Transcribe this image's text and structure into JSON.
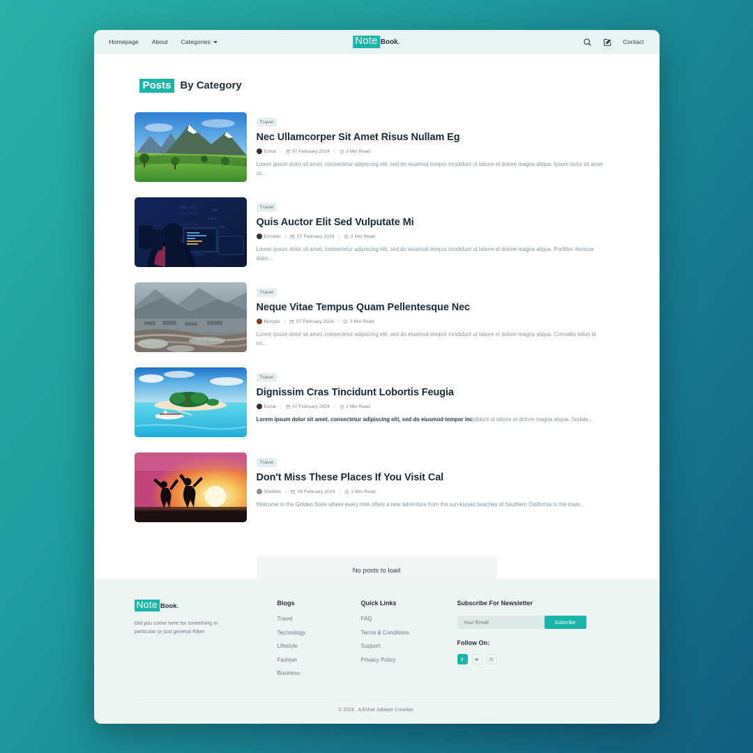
{
  "theme": {
    "accent": "#19b5a8",
    "page_bg": "#ffffff",
    "header_bg": "#e9f4f2",
    "footer_bg": "#eff5f3",
    "backdrop": "#1f9c9c"
  },
  "header": {
    "nav": [
      {
        "label": "Homepage",
        "caret": false
      },
      {
        "label": "About",
        "caret": false
      },
      {
        "label": "Categories",
        "caret": true
      }
    ],
    "logo": {
      "mark": "Note",
      "text": "Book",
      "dot": "."
    },
    "icons": [
      {
        "name": "search-icon"
      },
      {
        "name": "write-icon"
      }
    ],
    "contact_label": "Contact"
  },
  "main": {
    "title_highlight": "Posts",
    "title_rest": "By Category",
    "posts": [
      {
        "category": "Travel",
        "title": "Nec Ullamcorper Sit Amet Risus Nullam Eg",
        "author": "Eshat",
        "date": "07 February 2024",
        "read_time": "3 Min Read",
        "excerpt": "Lorem ipsum dolor sit amet, consectetur adipiscing elit, sed do eiusmod tempor incididunt ut labore et dolore magna aliqua. Ipsum dolor sit amet co...",
        "excerpt_bold": "",
        "image": "mountain-meadow",
        "avatar_color": "#3b2b2b"
      },
      {
        "category": "Travel",
        "title": "Quis Auctor Elit Sed Vulputate Mi",
        "author": "Einstein",
        "date": "07 February 2024",
        "read_time": "3 Min Read",
        "excerpt": "Lorem ipsum dolor sit amet, consectetur adipiscing elit, sed do eiusmod tempor incididunt ut labore et dolore magna aliqua. Porttitor rhoncus dolor...",
        "excerpt_bold": "",
        "image": "night-coding",
        "avatar_color": "#2f3640"
      },
      {
        "category": "Travel",
        "title": "Neque Vitae Tempus Quam Pellentesque Nec",
        "author": "Morgan",
        "date": "07 February 2024",
        "read_time": "3 Min Read",
        "excerpt": "Lorem ipsum dolor sit amet, consectetur adipiscing elit, sed do eiusmod tempor incididunt ut labore et dolore magna aliqua. Convallis tellus id int...",
        "excerpt_bold": "",
        "image": "terraced-valley",
        "avatar_color": "#7c3a2a"
      },
      {
        "category": "Travel",
        "title": "Dignissim Cras Tincidunt Lobortis Feugia",
        "author": "Eshat",
        "date": "07 February 2024",
        "read_time": "2 Min Read",
        "excerpt": "ididunt ut labore et dolore magna aliqua. Sodale...",
        "excerpt_bold": "Lorem ipsum dolor sit amet, consectetur adipiscing elit, sed do eiusmod tempor inc",
        "image": "tropical-island",
        "avatar_color": "#3b2b2b"
      },
      {
        "category": "Travel",
        "title": "Don't Miss These Places If You Visit Cal",
        "author": "Sheldon",
        "date": "06 February 2024",
        "read_time": "2 Min Read",
        "excerpt": "Welcome to the Golden State where every mile offers a new adventure from the sun-kissed beaches of Southern California to the towe...",
        "excerpt_bold": "",
        "image": "sunset-jump",
        "avatar_color": "#8a8f96"
      }
    ],
    "no_posts_label": "No posts to load"
  },
  "footer": {
    "logo": {
      "mark": "Note",
      "text": "Book",
      "dot": "."
    },
    "tagline": "Did you come here for something in particular or just general Riker",
    "blogs": {
      "heading": "Blogs",
      "links": [
        "Travel",
        "Technology",
        "Lifestyle",
        "Fashion",
        "Business"
      ]
    },
    "quick_links": {
      "heading": "Quick Links",
      "links": [
        "FAQ",
        "Terms & Conditions",
        "Support",
        "Privacy Policy"
      ]
    },
    "newsletter": {
      "heading": "Subscribe For Newsletter",
      "placeholder": "Your Email",
      "value": "",
      "button": "Subcribe"
    },
    "follow": {
      "heading": "Follow On:",
      "socials": [
        {
          "name": "facebook-icon",
          "active": true
        },
        {
          "name": "twitter-icon",
          "active": false
        },
        {
          "name": "instagram-icon",
          "active": false
        }
      ]
    },
    "copyright": "© 2024 . A Eshat Jubayer Creation."
  }
}
